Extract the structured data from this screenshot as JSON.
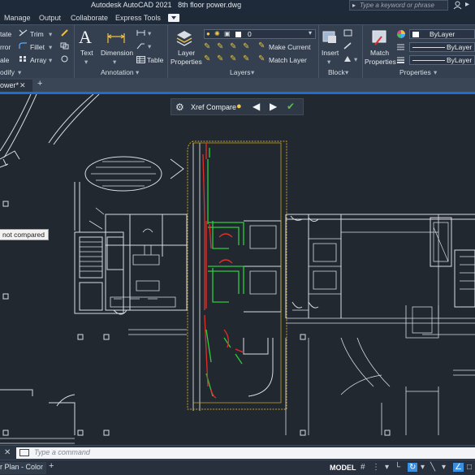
{
  "titlebar": {
    "title": "Autodesk AutoCAD 2021   8th floor power.dwg",
    "search_placeholder": "Type a keyword or phrase"
  },
  "menu_tabs": [
    "Manage",
    "Output",
    "Collaborate",
    "Express Tools"
  ],
  "ribbon": {
    "modify": {
      "items": [
        "tate",
        "Trim",
        "rror",
        "Fillet",
        "ale",
        "Array"
      ],
      "title": "odify"
    },
    "annotation": {
      "text": "Text",
      "dimension": "Dimension",
      "table": "Table",
      "title": "Annotation"
    },
    "layers": {
      "layer_properties": [
        "Layer",
        "Properties"
      ],
      "current_layer": "0",
      "make_current": "Make Current",
      "match_layer": "Match Layer",
      "title": "Layers"
    },
    "block": {
      "insert": "Insert",
      "title": "Block"
    },
    "properties": {
      "match_properties": [
        "Match",
        "Properties"
      ],
      "color": "ByLayer",
      "linetype": "ByLayer",
      "lineweight": "ByLayer",
      "title": "Properties"
    }
  },
  "document_tab": {
    "label": "ower*",
    "close": "✕"
  },
  "xref_compare": {
    "label": "Xref Compare"
  },
  "tooltip": "not compared",
  "command_line": {
    "placeholder": "Type a command"
  },
  "statusbar": {
    "layout_tab": "r Plan - Color",
    "model": "MODEL"
  },
  "colors": {
    "accent": "#1c6fd0",
    "compare_frame": "#c9a12a",
    "added": "#2ecc40",
    "removed": "#e0302a",
    "linework": "#d9dde3"
  }
}
